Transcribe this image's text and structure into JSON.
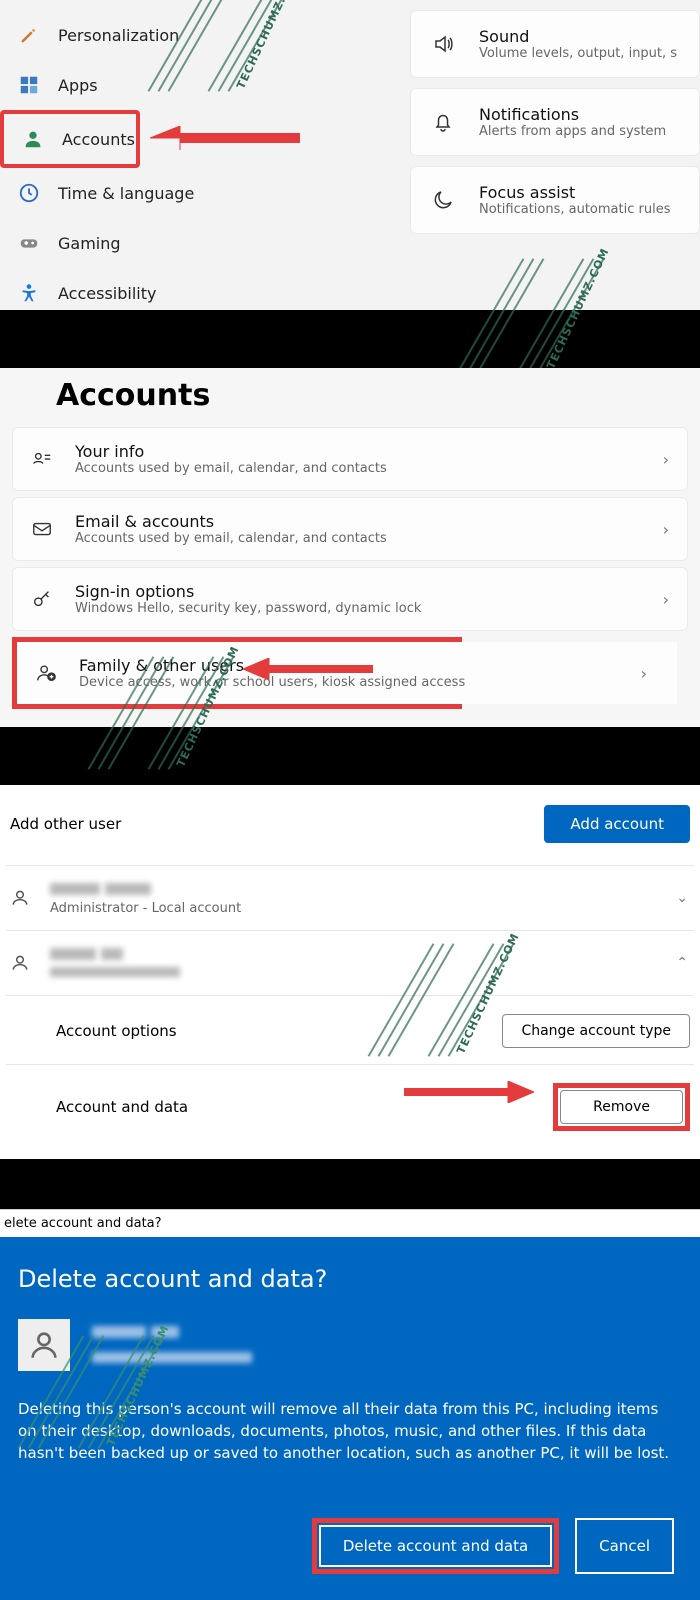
{
  "sidebar": {
    "items": [
      {
        "label": "Personalization"
      },
      {
        "label": "Apps"
      },
      {
        "label": "Accounts"
      },
      {
        "label": "Time & language"
      },
      {
        "label": "Gaming"
      },
      {
        "label": "Accessibility"
      }
    ]
  },
  "cards": [
    {
      "label": "Sound",
      "sub": "Volume levels, output, input, s"
    },
    {
      "label": "Notifications",
      "sub": "Alerts from apps and system"
    },
    {
      "label": "Focus assist",
      "sub": "Notifications, automatic rules"
    }
  ],
  "accounts": {
    "title": "Accounts",
    "rows": [
      {
        "label": "Your info",
        "sub": "Accounts used by email, calendar, and contacts"
      },
      {
        "label": "Email & accounts",
        "sub": "Accounts used by email, calendar, and contacts"
      },
      {
        "label": "Sign-in options",
        "sub": "Windows Hello, security key, password, dynamic lock"
      },
      {
        "label": "Family & other users",
        "sub": "Device access, work or school users, kiosk assigned access"
      }
    ]
  },
  "other_users": {
    "section_label": "Add other user",
    "add_btn": "Add account",
    "admin_sub": "Administrator - Local account",
    "opt_label": "Account options",
    "opt_btn": "Change account type",
    "data_label": "Account and data",
    "data_btn": "Remove"
  },
  "dialog": {
    "window_title": "elete account and data?",
    "heading": "Delete account and data?",
    "message": "Deleting this person's account will remove all their data from this PC, including items on their desktop, downloads, documents, photos, music, and other files. If this data hasn't been backed up or saved to another location, such as another PC, it will be lost.",
    "confirm": "Delete account and data",
    "cancel": "Cancel"
  },
  "watermark": "TECHSCHUMZ.COM"
}
